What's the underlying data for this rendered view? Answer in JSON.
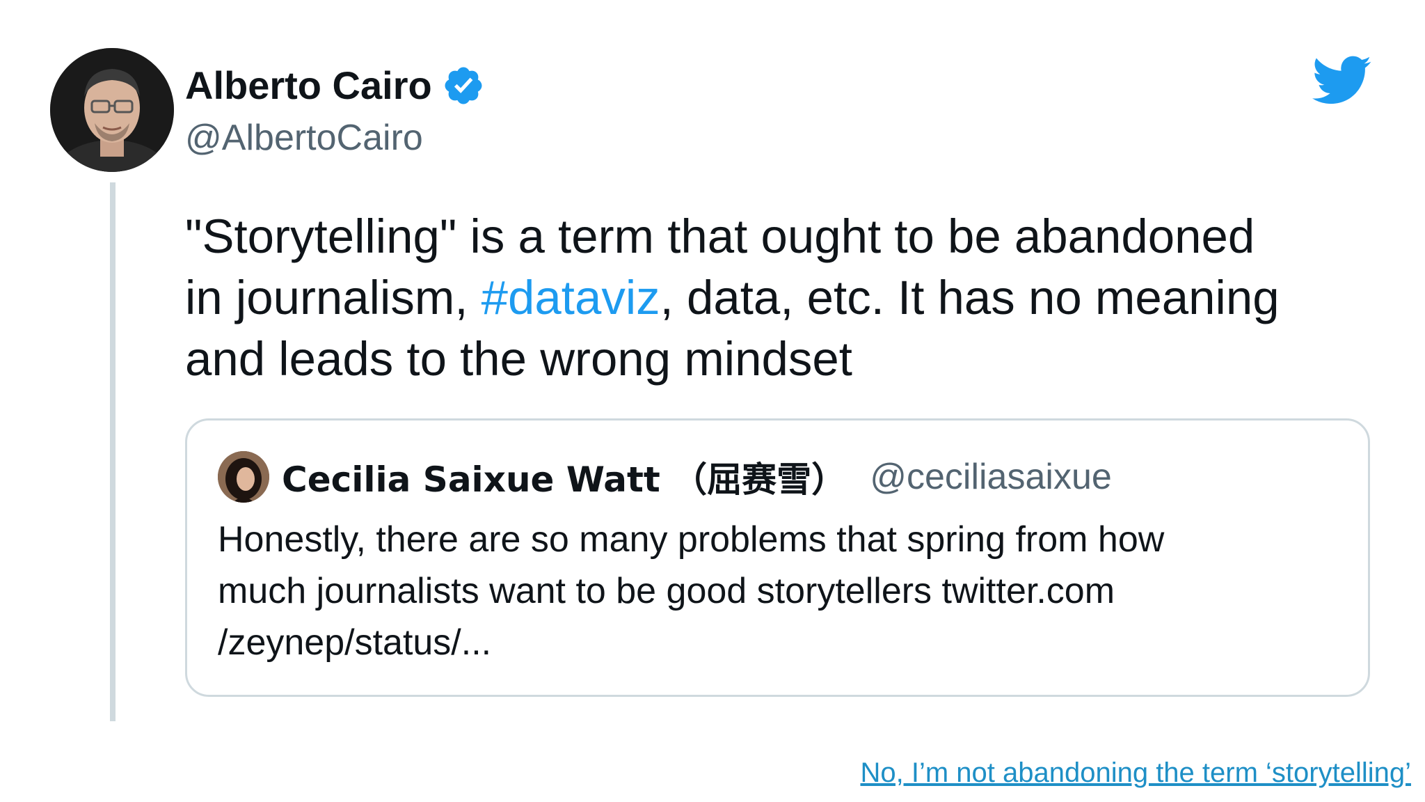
{
  "tweet": {
    "author": {
      "name": "Alberto Cairo",
      "handle": "@AlbertoCairo",
      "verified": true,
      "avatar_icon": "portrait-avatar"
    },
    "logo_icon": "twitter-bird-icon",
    "text_lines": [
      "\"Storytelling\" is a term that ought to be abandoned",
      "in journalism, ",
      "#dataviz",
      ", data, etc. It has no meaning",
      "and leads to the wrong mindset"
    ],
    "quoted": {
      "name": "Cecilia Saixue Watt （屈赛雪）",
      "handle": "@ceciliasaixue",
      "text_lines": [
        "Honestly, there are so many problems that spring from how",
        "much journalists want to be good storytellers twitter.com",
        "/zeynep/status/..."
      ]
    }
  },
  "footer": {
    "link_text": "No, I’m not abandoning the term ‘storytelling’"
  },
  "colors": {
    "accent": "#1d9bf0",
    "secondary_text": "#536471",
    "border": "#cfd9de",
    "link": "#1e8fc6"
  }
}
